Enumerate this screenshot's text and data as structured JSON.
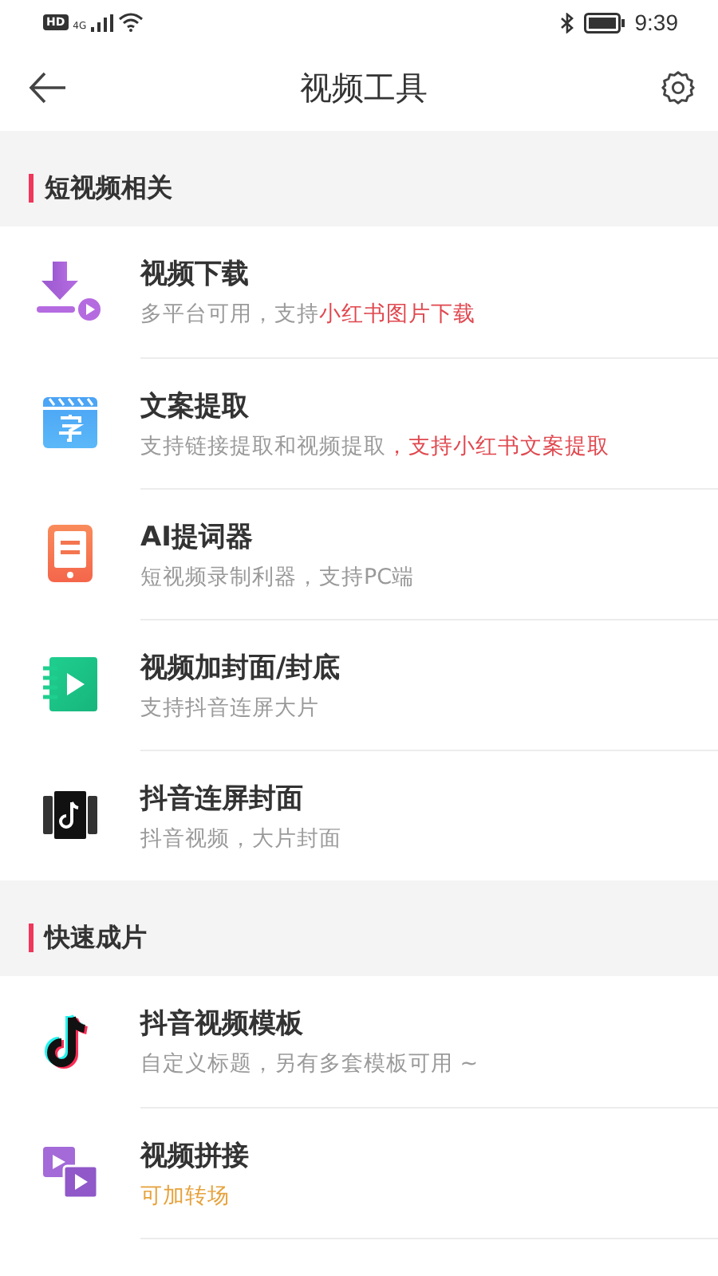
{
  "status_bar": {
    "hd_badge": "HD",
    "network": "4G",
    "time": "9:39"
  },
  "header": {
    "title": "视频工具"
  },
  "sections": [
    {
      "title": "短视频相关",
      "items": [
        {
          "kind": "download",
          "title": "视频下载",
          "subtitle": [
            {
              "text": "多平台可用，支持",
              "color": "#9a9a9a"
            },
            {
              "text": "小红书图片下载",
              "color": "#e0484f"
            }
          ]
        },
        {
          "kind": "caption",
          "title": "文案提取",
          "subtitle": [
            {
              "text": "支持链接提取和视频提取",
              "color": "#9a9a9a"
            },
            {
              "text": "，支持小红书文案提取",
              "color": "#e0484f"
            }
          ]
        },
        {
          "kind": "phone",
          "title": "AI提词器",
          "subtitle": [
            {
              "text": "短视频录制利器，支持PC端",
              "color": "#9a9a9a"
            }
          ]
        },
        {
          "kind": "cover",
          "title": "视频加封面/封底",
          "subtitle": [
            {
              "text": "支持抖音连屏大片",
              "color": "#9a9a9a"
            }
          ]
        },
        {
          "kind": "panorama",
          "title": "抖音连屏封面",
          "subtitle": [
            {
              "text": "抖音视频，大片封面",
              "color": "#9a9a9a"
            }
          ]
        }
      ]
    },
    {
      "title": "快速成片",
      "items": [
        {
          "kind": "note",
          "title": "抖音视频模板",
          "subtitle": [
            {
              "text": "自定义标题，另有多套模板可用 ~",
              "color": "#9a9a9a"
            }
          ]
        },
        {
          "kind": "merge",
          "title": "视频拼接",
          "subtitle": [
            {
              "text": "可加转场",
              "color": "#e6a23c"
            }
          ]
        }
      ]
    }
  ]
}
